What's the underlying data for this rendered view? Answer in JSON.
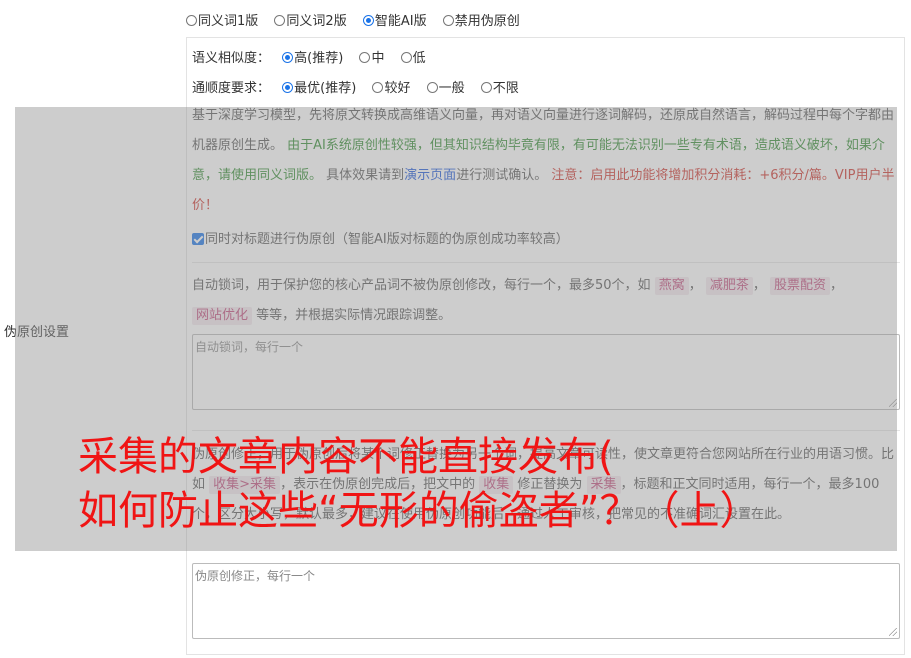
{
  "mode_options": [
    {
      "label": "同义词1版",
      "checked": false
    },
    {
      "label": "同义词2版",
      "checked": false
    },
    {
      "label": "智能AI版",
      "checked": true
    },
    {
      "label": "禁用伪原创",
      "checked": false
    }
  ],
  "side_label": "伪原创设置",
  "similarity": {
    "label": "语义相似度：",
    "options": [
      {
        "label": "高(推荐)",
        "checked": true
      },
      {
        "label": "中",
        "checked": false
      },
      {
        "label": "低",
        "checked": false
      }
    ]
  },
  "fluency": {
    "label": "通顺度要求：",
    "options": [
      {
        "label": "最优(推荐)",
        "checked": true
      },
      {
        "label": "较好",
        "checked": false
      },
      {
        "label": "一般",
        "checked": false
      },
      {
        "label": "不限",
        "checked": false
      }
    ]
  },
  "description": {
    "p1": "基于深度学习模型，先将原文转换成高维语义向量，再对语义向量进行逐词解码，还原成自然语言，解码过程中每个字都由机器原创生成。",
    "warn_green": "由于AI系统原创性较强，但其知识结构毕竟有限，有可能无法识别一些专有术语，造成语义破坏，如果介意，请使用同义词版。",
    "p2": "具体效果请到",
    "link": "演示页面",
    "p3": "进行测试确认。",
    "warn_red": "注意：启用此功能将增加积分消耗：+6积分/篇。VIP用户半价！"
  },
  "title_checkbox_label": "同时对标题进行伪原创（智能AI版对标题的伪原创成功率较高）",
  "lock": {
    "intro": "自动锁词，用于保护您的核心产品词不被伪原创修改，每行一个，最多50个，如",
    "tags": [
      "燕窝",
      "减肥茶",
      "股票配资",
      "网站优化"
    ],
    "tail": "等等，并根据实际情况跟踪调整。",
    "placeholder": "自动锁词，每行一个"
  },
  "fix": {
    "intro": "伪原创修正，用于伪原创后将某个词修正替换为另一个词，提高文章可读性，使文章更符合您网站所在行业的用语习惯。比如",
    "example_from": "收集>采集",
    "mid1": "，表示在伪原创完成后，把文中的",
    "word_a": "收集",
    "mid2": "修正替换为",
    "word_b": "采集",
    "tail": "，标题和正文同时适用，每行一个，最多100个，区分大小写，默认最多，建议在使用伪原创功能后，通过人工审核，把常见的不准确词汇设置在此。",
    "placeholder": "伪原创修正，每行一个"
  },
  "headline": {
    "line1": "采集的文章内容不能直接发布(",
    "line2": "如何防止这些“无形的偷盗者”？（上）"
  }
}
